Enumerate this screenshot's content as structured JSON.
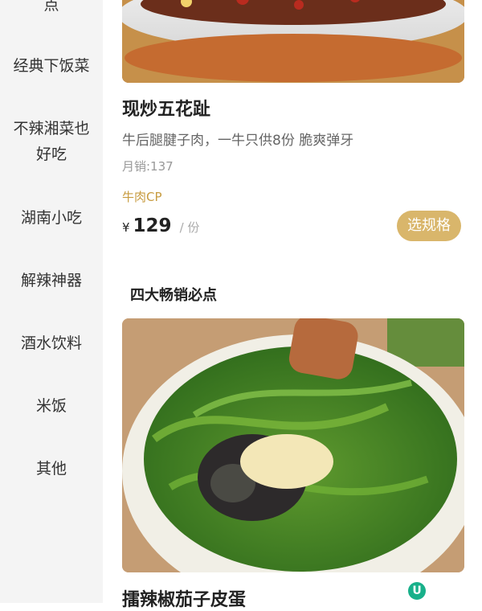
{
  "sidebar": {
    "items": [
      {
        "label": "点"
      },
      {
        "label": "经典下饭菜"
      },
      {
        "label": "不辣湘菜也"
      },
      {
        "label": "好吃"
      },
      {
        "label": "湖南小吃"
      },
      {
        "label": "解辣神器"
      },
      {
        "label": "酒水饮料"
      },
      {
        "label": "米饭"
      },
      {
        "label": "其他"
      }
    ]
  },
  "main": {
    "dish1": {
      "title": "现炒五花趾",
      "desc": "牛后腿腱子肉，一牛只供8份 脆爽弹牙",
      "sales": "月销:137",
      "tag": "牛肉CP",
      "price_symbol": "¥",
      "price": "129",
      "unit": "/ 份",
      "button": "选规格"
    },
    "section_title": "四大畅销必点",
    "dish2": {
      "title": "擂辣椒茄子皮蛋",
      "badge": "U"
    }
  },
  "colors": {
    "accent": "#d9b66b",
    "tag": "#c79b3f",
    "sidebar_bg": "#f4f4f4"
  }
}
